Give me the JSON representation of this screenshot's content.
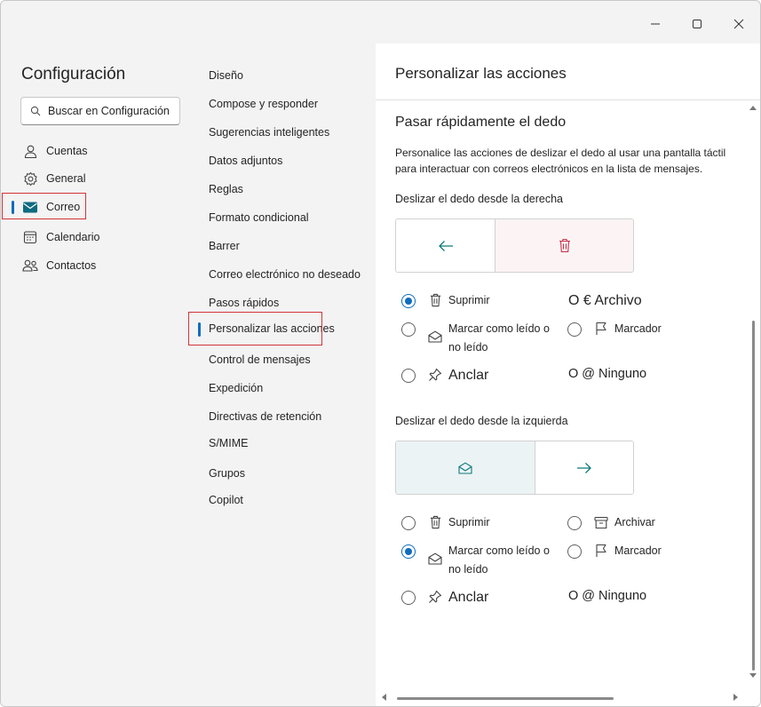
{
  "window": {
    "controls": [
      "minimize-icon",
      "maximize-icon",
      "close-icon"
    ]
  },
  "left": {
    "title": "Configuración",
    "search_placeholder": "Buscar en Configuración",
    "items": [
      {
        "label": "Cuentas",
        "icon": "person-icon"
      },
      {
        "label": "General",
        "icon": "gear-icon"
      },
      {
        "label": "Correo",
        "icon": "mail-icon",
        "active": true
      },
      {
        "label": "Calendario",
        "icon": "calendar-icon"
      },
      {
        "label": "Contactos",
        "icon": "people-icon"
      }
    ]
  },
  "middle": {
    "items": [
      "Diseño",
      "Compose y responder",
      "Sugerencias inteligentes",
      "Datos adjuntos",
      "Reglas",
      "Formato condicional",
      "Barrer",
      "Correo electrónico no deseado",
      "Pasos rápidos",
      "Personalizar las acciones",
      "Control de mensajes",
      "Expedición",
      "Directivas de retención",
      "S/MIME",
      "Grupos",
      "Copilot"
    ],
    "active_index": 9
  },
  "right": {
    "title": "Personalizar las acciones",
    "section_title": "Pasar rápidamente el dedo",
    "description": "Personalice las acciones de deslizar el dedo al usar una pantalla táctil para interactuar con correos electrónicos en la lista de mensajes.",
    "right_swipe": {
      "label": "Deslizar el dedo desde la derecha",
      "options": {
        "delete": "Suprimir",
        "archive": "O € Archivo",
        "mark_read_1": "Marcar como leído o",
        "mark_read_2": "no leído",
        "flag": "Marcador",
        "pin": "Anclar",
        "none": "O @ Ninguno"
      },
      "selected": "delete"
    },
    "left_swipe": {
      "label": "Deslizar el dedo desde la izquierda",
      "options": {
        "delete": "Suprimir",
        "archive": "Archivar",
        "mark_read_1": "Marcar como leído o",
        "mark_read_2": "no leído",
        "flag": "Marcador",
        "pin": "Anclar",
        "none": "O @ Ninguno"
      },
      "selected": "mark_read"
    }
  },
  "colors": {
    "accent": "#0f6cbd",
    "teal": "#0e7a7a",
    "delete_red": "#c4314b",
    "highlight_red": "#d13438",
    "delete_bg": "#fcf4f4",
    "read_bg": "#ebf3f5"
  }
}
